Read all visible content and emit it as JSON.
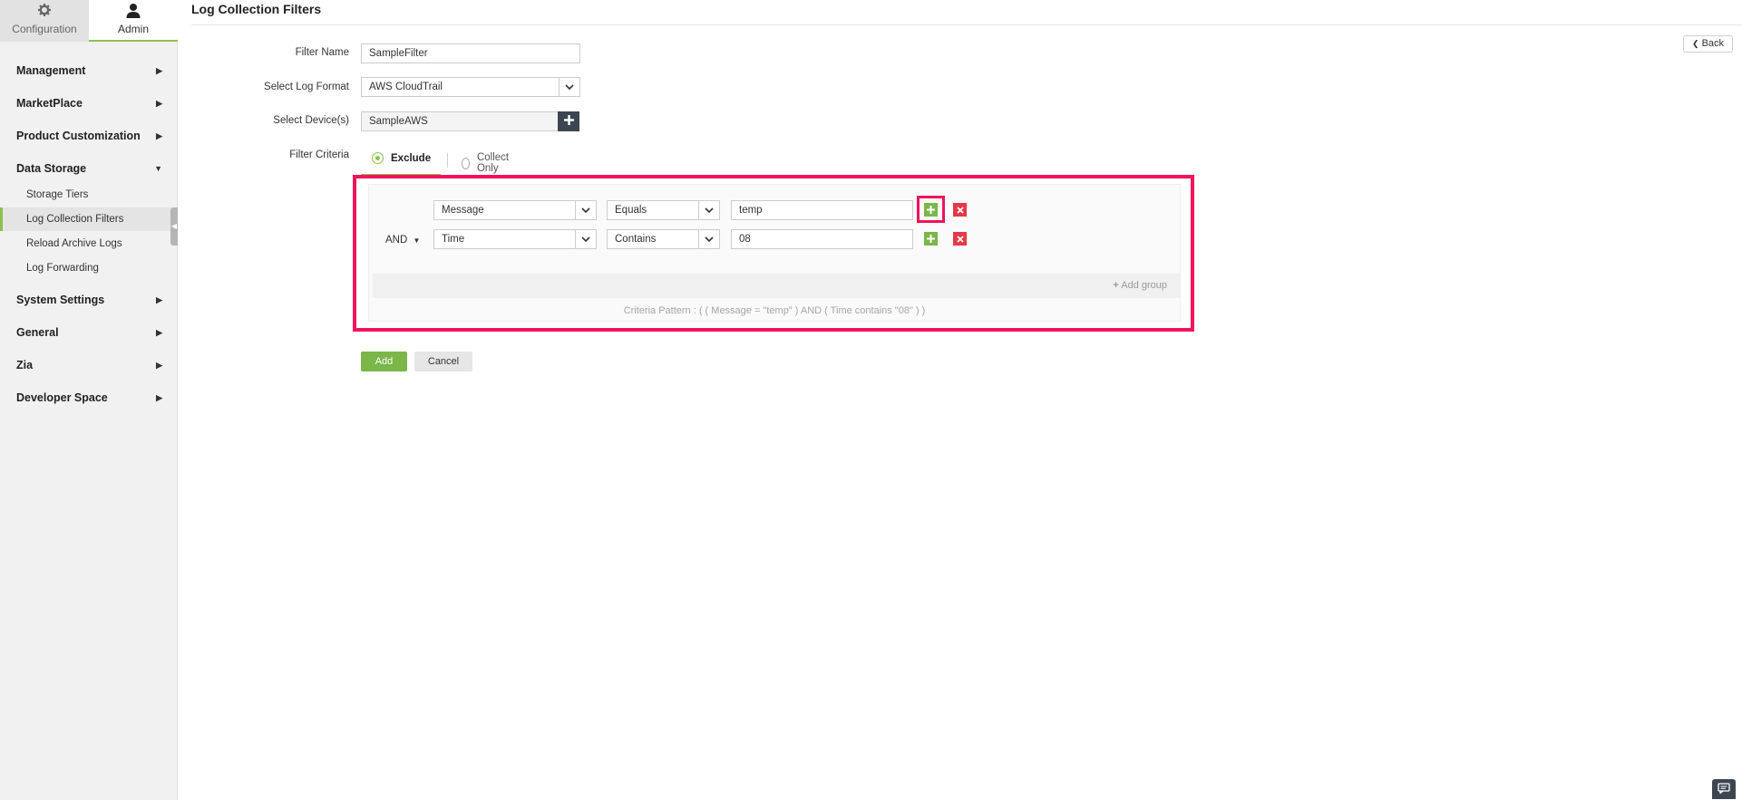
{
  "sidebar": {
    "tabs": [
      {
        "label": "Configuration",
        "icon": "gear-icon"
      },
      {
        "label": "Admin",
        "icon": "user-icon"
      }
    ],
    "groups": [
      {
        "label": "Management"
      },
      {
        "label": "MarketPlace"
      },
      {
        "label": "Product Customization"
      },
      {
        "label": "Data Storage"
      },
      {
        "label": "System Settings"
      },
      {
        "label": "General"
      },
      {
        "label": "Zia"
      },
      {
        "label": "Developer Space"
      }
    ],
    "data_storage_items": [
      {
        "label": "Storage Tiers"
      },
      {
        "label": "Log Collection Filters",
        "active": true
      },
      {
        "label": "Reload Archive Logs"
      },
      {
        "label": "Log Forwarding"
      }
    ]
  },
  "page": {
    "title": "Log Collection Filters",
    "back_label": "Back"
  },
  "form": {
    "filter_name_label": "Filter Name",
    "filter_name_value": "SampleFilter",
    "log_format_label": "Select Log Format",
    "log_format_value": "AWS CloudTrail",
    "devices_label": "Select Device(s)",
    "devices_value": "SampleAWS",
    "criteria_label": "Filter Criteria",
    "radio_exclude": "Exclude",
    "radio_collect_only": "Collect Only",
    "selected_mode": "Exclude"
  },
  "criteria": {
    "conditions": [
      {
        "field": "Message",
        "operator": "Equals",
        "value": "temp"
      },
      {
        "field": "Time",
        "operator": "Contains",
        "value": "08"
      }
    ],
    "join_operator": "AND",
    "add_group_label": "Add group",
    "pattern_text": "Criteria Pattern : ( ( Message = \"temp\" ) AND ( Time contains \"08\" ) )"
  },
  "actions": {
    "add_label": "Add",
    "cancel_label": "Cancel"
  },
  "colors": {
    "accent_green": "#8bc34a",
    "button_green": "#7ab648",
    "delete_red": "#e53946",
    "highlight_pink": "#f0145a",
    "dark_slate": "#3d4650"
  }
}
